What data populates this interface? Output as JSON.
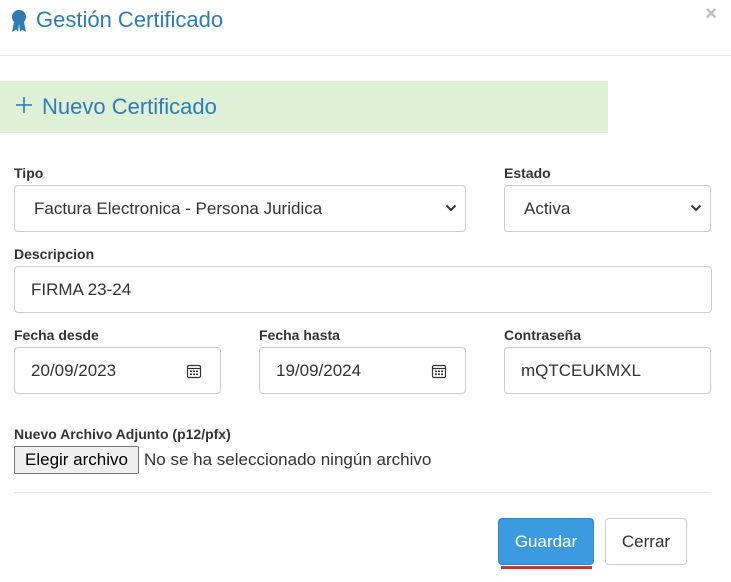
{
  "modal": {
    "title": "Gestión Certificado",
    "title_icon": "award-ribbon-icon",
    "close_label": "×",
    "accent_color": "#2f7bb5"
  },
  "section": {
    "title": "Nuevo Certificado",
    "icon": "plus-icon",
    "background_color": "#dff0d8"
  },
  "form": {
    "tipo": {
      "label": "Tipo",
      "value": "Factura Electronica - Persona Juridica"
    },
    "estado": {
      "label": "Estado",
      "value": "Activa"
    },
    "descripcion": {
      "label": "Descripcion",
      "value": "FIRMA 23-24"
    },
    "fecha_desde": {
      "label": "Fecha desde",
      "value": "20/09/2023",
      "icon": "calendar-icon"
    },
    "fecha_hasta": {
      "label": "Fecha hasta",
      "value": "19/09/2024",
      "icon": "calendar-icon"
    },
    "contrasena": {
      "label": "Contraseña",
      "value": "mQTCEUKMXL"
    },
    "archivo": {
      "label": "Nuevo Archivo Adjunto (p12/pfx)",
      "button_label": "Elegir archivo",
      "status": "No se ha seleccionado ningún archivo"
    }
  },
  "footer": {
    "save_label": "Guardar",
    "close_label": "Cerrar",
    "primary_color": "#3c9be0"
  }
}
